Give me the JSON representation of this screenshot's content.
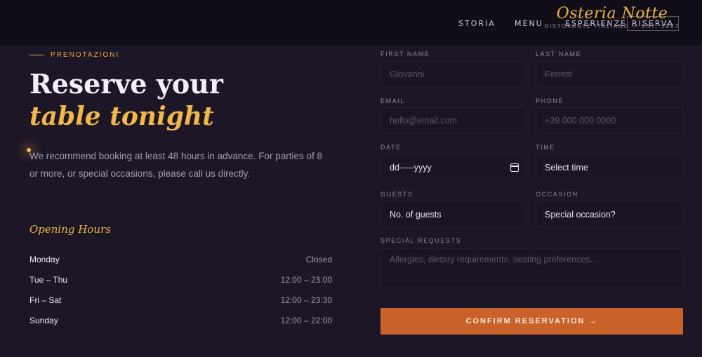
{
  "nav": {
    "items": [
      "STORIA",
      "MENU",
      "ESPERIENZE",
      "RISERVA"
    ],
    "logo_script": "Osteria Notte",
    "logo_sub": "RISTORANTE ITALIANO — EST. 1987"
  },
  "hero": {
    "eyebrow": "PRENOTAZIONI",
    "title_line1": "Reserve your",
    "title_line2": "table tonight",
    "intro": "We recommend booking at least 48 hours in advance. For parties of 8 or more, or special occasions, please call us directly."
  },
  "hours": {
    "title": "Opening Hours",
    "rows": [
      {
        "day": "Monday",
        "time": "Closed"
      },
      {
        "day": "Tue – Thu",
        "time": "12:00 – 23:00"
      },
      {
        "day": "Fri – Sat",
        "time": "12:00 – 23:30"
      },
      {
        "day": "Sunday",
        "time": "12:00 – 22:00"
      }
    ]
  },
  "form": {
    "first_name": {
      "label": "FIRST NAME",
      "placeholder": "Giovanni"
    },
    "last_name": {
      "label": "LAST NAME",
      "placeholder": "Ferretti"
    },
    "email": {
      "label": "EMAIL",
      "placeholder": "hello@email.com"
    },
    "phone": {
      "label": "PHONE",
      "placeholder": "+39 000 000 0000"
    },
    "date": {
      "label": "DATE",
      "value": "dd-----yyyy"
    },
    "time": {
      "label": "TIME",
      "value": "Select time"
    },
    "guests": {
      "label": "GUESTS",
      "value": "No. of guests"
    },
    "occasion": {
      "label": "OCCASION",
      "value": "Special occasion?"
    },
    "requests": {
      "label": "SPECIAL REQUESTS",
      "placeholder": "Allergies, dietary requirements, seating preferences..."
    },
    "submit": "CONFIRM RESERVATION →"
  },
  "colors": {
    "accent": "#f0b848",
    "button": "#c8622a",
    "background": "#1d1627"
  }
}
